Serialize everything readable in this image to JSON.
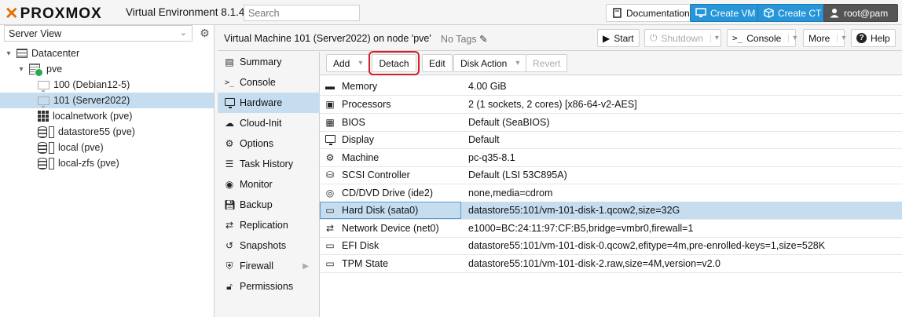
{
  "topbar": {
    "brand": "PROXMOX",
    "version_text": "Virtual Environment 8.1.4",
    "search_placeholder": "Search",
    "documentation_label": "Documentation",
    "create_vm_label": "Create VM",
    "create_ct_label": "Create CT",
    "user_label": "root@pam",
    "accent_color": "#e57000",
    "button_blue": "#2796d8"
  },
  "sidebar": {
    "view_select": "Server View",
    "tree": [
      {
        "label": "Datacenter",
        "icon": "datacenter-icon"
      },
      {
        "label": "pve",
        "icon": "server-icon"
      },
      {
        "label": "100 (Debian12-5)",
        "icon": "vm-icon"
      },
      {
        "label": "101 (Server2022)",
        "icon": "vm-icon",
        "selected": true
      },
      {
        "label": "localnetwork (pve)",
        "icon": "network-grid-icon"
      },
      {
        "label": "datastore55 (pve)",
        "icon": "storage-icon"
      },
      {
        "label": "local (pve)",
        "icon": "storage-icon"
      },
      {
        "label": "local-zfs (pve)",
        "icon": "storage-icon"
      }
    ]
  },
  "vm_header": {
    "title": "Virtual Machine 101 (Server2022) on node 'pve'",
    "tags": "No Tags",
    "start_label": "Start",
    "shutdown_label": "Shutdown",
    "console_label": "Console",
    "more_label": "More",
    "help_label": "Help"
  },
  "menu": [
    {
      "label": "Summary",
      "icon": "summary-icon"
    },
    {
      "label": "Console",
      "icon": "terminal-icon"
    },
    {
      "label": "Hardware",
      "icon": "monitor-icon",
      "selected": true
    },
    {
      "label": "Cloud-Init",
      "icon": "cloud-icon"
    },
    {
      "label": "Options",
      "icon": "gear-icon"
    },
    {
      "label": "Task History",
      "icon": "list-icon"
    },
    {
      "label": "Monitor",
      "icon": "eye-icon"
    },
    {
      "label": "Backup",
      "icon": "floppy-icon"
    },
    {
      "label": "Replication",
      "icon": "retweet-icon"
    },
    {
      "label": "Snapshots",
      "icon": "history-icon"
    },
    {
      "label": "Firewall",
      "icon": "shield-icon"
    },
    {
      "label": "Permissions",
      "icon": "unlock-icon"
    }
  ],
  "hardware_toolbar": {
    "add_label": "Add",
    "detach_label": "Detach",
    "edit_label": "Edit",
    "disk_action_label": "Disk Action",
    "revert_label": "Revert"
  },
  "hardware": [
    {
      "key": "Memory",
      "value": "4.00 GiB",
      "icon": "memory-icon"
    },
    {
      "key": "Processors",
      "value": "2 (1 sockets, 2 cores) [x86-64-v2-AES]",
      "icon": "cpu-icon"
    },
    {
      "key": "BIOS",
      "value": "Default (SeaBIOS)",
      "icon": "microchip-icon"
    },
    {
      "key": "Display",
      "value": "Default",
      "icon": "desktop-icon"
    },
    {
      "key": "Machine",
      "value": "pc-q35-8.1",
      "icon": "cogs-icon"
    },
    {
      "key": "SCSI Controller",
      "value": "Default (LSI 53C895A)",
      "icon": "database-icon"
    },
    {
      "key": "CD/DVD Drive (ide2)",
      "value": "none,media=cdrom",
      "icon": "cdrom-icon"
    },
    {
      "key": "Hard Disk (sata0)",
      "value": "datastore55:101/vm-101-disk-1.qcow2,size=32G",
      "icon": "hdd-icon",
      "selected": true
    },
    {
      "key": "Network Device (net0)",
      "value": "e1000=BC:24:11:97:CF:B5,bridge=vmbr0,firewall=1",
      "icon": "exchange-icon"
    },
    {
      "key": "EFI Disk",
      "value": "datastore55:101/vm-101-disk-0.qcow2,efitype=4m,pre-enrolled-keys=1,size=528K",
      "icon": "hdd-icon"
    },
    {
      "key": "TPM State",
      "value": "datastore55:101/vm-101-disk-2.raw,size=4M,version=v2.0",
      "icon": "hdd-icon"
    }
  ]
}
